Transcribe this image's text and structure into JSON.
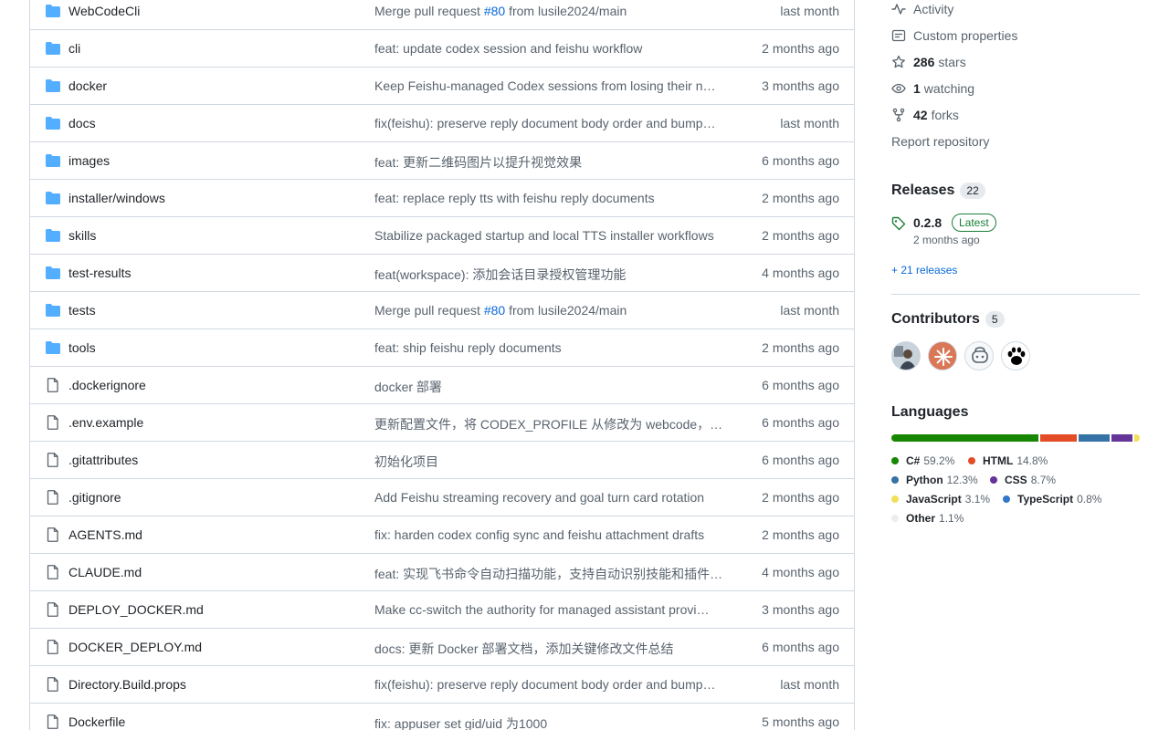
{
  "files": [
    {
      "name": "WebCodeCli",
      "type": "dir",
      "msg_pre": "Merge pull request ",
      "msg_link": "#80",
      "msg_post": " from lusile2024/main",
      "date": "last month"
    },
    {
      "name": "cli",
      "type": "dir",
      "msg_pre": "feat: update codex session and feishu workflow",
      "msg_link": "",
      "msg_post": "",
      "date": "2 months ago"
    },
    {
      "name": "docker",
      "type": "dir",
      "msg_pre": "Keep Feishu-managed Codex sessions from losing their n…",
      "msg_link": "",
      "msg_post": "",
      "date": "3 months ago"
    },
    {
      "name": "docs",
      "type": "dir",
      "msg_pre": "fix(feishu): preserve reply document body order and bump…",
      "msg_link": "",
      "msg_post": "",
      "date": "last month"
    },
    {
      "name": "images",
      "type": "dir",
      "msg_pre": "feat: 更新二维码图片以提升视觉效果",
      "msg_link": "",
      "msg_post": "",
      "date": "6 months ago"
    },
    {
      "name": "installer/windows",
      "type": "dir",
      "msg_pre": "feat: replace reply tts with feishu reply documents",
      "msg_link": "",
      "msg_post": "",
      "date": "2 months ago"
    },
    {
      "name": "skills",
      "type": "dir",
      "msg_pre": "Stabilize packaged startup and local TTS installer workflows",
      "msg_link": "",
      "msg_post": "",
      "date": "2 months ago"
    },
    {
      "name": "test-results",
      "type": "dir",
      "msg_pre": "feat(workspace): 添加会话目录授权管理功能",
      "msg_link": "",
      "msg_post": "",
      "date": "4 months ago"
    },
    {
      "name": "tests",
      "type": "dir",
      "msg_pre": "Merge pull request ",
      "msg_link": "#80",
      "msg_post": " from lusile2024/main",
      "date": "last month"
    },
    {
      "name": "tools",
      "type": "dir",
      "msg_pre": "feat: ship feishu reply documents",
      "msg_link": "",
      "msg_post": "",
      "date": "2 months ago"
    },
    {
      "name": ".dockerignore",
      "type": "file",
      "msg_pre": "docker 部署",
      "msg_link": "",
      "msg_post": "",
      "date": "6 months ago"
    },
    {
      "name": ".env.example",
      "type": "file",
      "msg_pre": "更新配置文件，将 CODEX_PROFILE 从修改为 webcode，…",
      "msg_link": "",
      "msg_post": "",
      "date": "6 months ago"
    },
    {
      "name": ".gitattributes",
      "type": "file",
      "msg_pre": "初始化项目",
      "msg_link": "",
      "msg_post": "",
      "date": "6 months ago"
    },
    {
      "name": ".gitignore",
      "type": "file",
      "msg_pre": "Add Feishu streaming recovery and goal turn card rotation",
      "msg_link": "",
      "msg_post": "",
      "date": "2 months ago"
    },
    {
      "name": "AGENTS.md",
      "type": "file",
      "msg_pre": "fix: harden codex config sync and feishu attachment drafts",
      "msg_link": "",
      "msg_post": "",
      "date": "2 months ago"
    },
    {
      "name": "CLAUDE.md",
      "type": "file",
      "msg_pre": "feat: 实现飞书命令自动扫描功能，支持自动识别技能和插件…",
      "msg_link": "",
      "msg_post": "",
      "date": "4 months ago"
    },
    {
      "name": "DEPLOY_DOCKER.md",
      "type": "file",
      "msg_pre": "Make cc-switch the authority for managed assistant provi…",
      "msg_link": "",
      "msg_post": "",
      "date": "3 months ago"
    },
    {
      "name": "DOCKER_DEPLOY.md",
      "type": "file",
      "msg_pre": "docs: 更新 Docker 部署文档，添加关键修改文件总结",
      "msg_link": "",
      "msg_post": "",
      "date": "6 months ago"
    },
    {
      "name": "Directory.Build.props",
      "type": "file",
      "msg_pre": "fix(feishu): preserve reply document body order and bump…",
      "msg_link": "",
      "msg_post": "",
      "date": "last month"
    },
    {
      "name": "Dockerfile",
      "type": "file",
      "msg_pre": "fix: appuser set gid/uid 为1000",
      "msg_link": "",
      "msg_post": "",
      "date": "5 months ago"
    }
  ],
  "sidebar": {
    "activity": "Activity",
    "custom_properties": "Custom properties",
    "stars_count": "286",
    "stars_label": "stars",
    "watching_count": "1",
    "watching_label": "watching",
    "forks_count": "42",
    "forks_label": "forks",
    "report": "Report repository"
  },
  "releases": {
    "title": "Releases",
    "count": "22",
    "version": "0.2.8",
    "badge": "Latest",
    "date": "2 months ago",
    "more": "+ 21 releases"
  },
  "contributors": {
    "title": "Contributors",
    "count": "5"
  },
  "languages": {
    "title": "Languages",
    "items": [
      {
        "name": "C#",
        "pct": "59.2%",
        "value": 59.2,
        "color": "#178600"
      },
      {
        "name": "HTML",
        "pct": "14.8%",
        "value": 14.8,
        "color": "#e34c26"
      },
      {
        "name": "Python",
        "pct": "12.3%",
        "value": 12.3,
        "color": "#3572A5"
      },
      {
        "name": "CSS",
        "pct": "8.7%",
        "value": 8.7,
        "color": "#663399"
      },
      {
        "name": "JavaScript",
        "pct": "3.1%",
        "value": 3.1,
        "color": "#f1e05a"
      },
      {
        "name": "TypeScript",
        "pct": "0.8%",
        "value": 0.8,
        "color": "#3178c6"
      },
      {
        "name": "Other",
        "pct": "1.1%",
        "value": 1.1,
        "color": "#ededed"
      }
    ]
  },
  "colors": {
    "link": "#0969da",
    "folder": "#54aeff",
    "latest_green": "#1a7f37"
  }
}
